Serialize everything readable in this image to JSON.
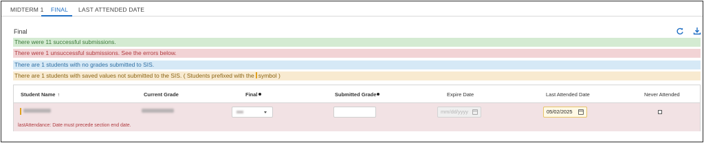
{
  "tabs": [
    {
      "label": "MIDTERM 1"
    },
    {
      "label": "FINAL"
    },
    {
      "label": "LAST ATTENDED DATE"
    }
  ],
  "section": {
    "title": "Final"
  },
  "toolbar": {
    "refresh_icon": "refresh-icon",
    "download_icon": "download-icon"
  },
  "banners": {
    "success": "There were 11 successful submissions.",
    "error": "There were 1 unsuccessful submissions. See the errors below.",
    "info": "There are 1 students with no grades submitted to SIS.",
    "warning_before": "There are 1 students with saved values not submitted to the SIS. ( Students prefixed with the",
    "warning_after": "symbol )"
  },
  "table": {
    "headers": {
      "student_name": "Student Name",
      "current_grade": "Current Grade",
      "final": "Final",
      "submitted_grade": "Submitted Grade",
      "expire_date": "Expire Date",
      "last_attended_date": "Last Attended Date",
      "never_attended": "Never Attended"
    },
    "row": {
      "expire_placeholder": "mm/dd/yyyy",
      "last_attended_value": "05/02/2025",
      "error": "lastAttendance: Date must precede section end date."
    }
  },
  "colors": {
    "accent": "#1f6fc4",
    "success_bg": "#d4ebd2",
    "error_bg": "#f2d3d5",
    "info_bg": "#d6e9f6",
    "warning_bg": "#f8ead0",
    "unsubmitted_marker": "#e0a01c"
  }
}
